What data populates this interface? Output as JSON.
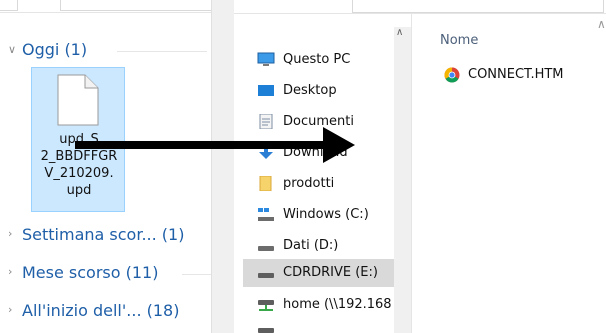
{
  "left_pane": {
    "groups": [
      {
        "label": "Oggi (1)",
        "expanded": true
      },
      {
        "label": "Settimana scor... (1)",
        "expanded": false
      },
      {
        "label": "Mese scorso (11)",
        "expanded": false
      },
      {
        "label": "All'inizio dell'... (18)",
        "expanded": false
      }
    ],
    "selected_file": {
      "lines": [
        "upd_S",
        "2_BBDFFGR",
        "V_210209.",
        "upd"
      ],
      "icon": "blank-file-icon"
    }
  },
  "nav_pane": {
    "items": [
      {
        "label": "Questo PC",
        "icon": "this-pc-icon",
        "selected": false
      },
      {
        "label": "Desktop",
        "icon": "desktop-folder-icon",
        "selected": false
      },
      {
        "label": "Documenti",
        "icon": "documents-folder-icon",
        "selected": false
      },
      {
        "label": "Download",
        "icon": "downloads-folder-icon",
        "selected": false
      },
      {
        "label": "prodotti",
        "icon": "folder-icon",
        "selected": false
      },
      {
        "label": "Windows (C:)",
        "icon": "windows-drive-icon",
        "selected": false
      },
      {
        "label": "Dati (D:)",
        "icon": "drive-icon",
        "selected": false
      },
      {
        "label": "CDRDRIVE (E:)",
        "icon": "drive-icon",
        "selected": true
      },
      {
        "label": "home (\\\\192.168",
        "icon": "network-drive-icon",
        "selected": false
      },
      {
        "label": "",
        "icon": "network-drive-icon",
        "selected": false
      }
    ]
  },
  "content_pane": {
    "column_header": "Nome",
    "files": [
      {
        "name": "CONNECT.HTM",
        "icon": "chrome-html-icon"
      }
    ]
  },
  "colors": {
    "link_blue": "#1f5fa8",
    "selection_bg": "#cce8ff",
    "selection_border": "#99d1ff",
    "nav_selected_bg": "#d9d9d9",
    "arrow": "#000000"
  },
  "annotation": {
    "icon": "drag-arrow-icon"
  }
}
